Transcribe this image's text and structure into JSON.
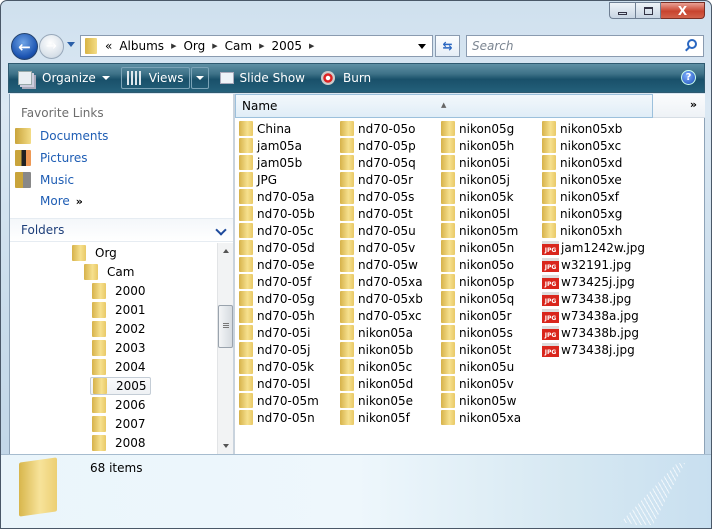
{
  "window": {
    "caption_buttons": [
      "minimize",
      "maximize",
      "close"
    ],
    "close_label": "X"
  },
  "nav": {
    "back_icon": "←",
    "forward_icon": "→",
    "address": {
      "overflow": "«",
      "crumbs": [
        "Albums",
        "Org",
        "Cam",
        "2005"
      ],
      "separator": "▶"
    },
    "refresh_icon": "⇆",
    "search_placeholder": "Search"
  },
  "toolbar": {
    "organize": "Organize",
    "views": "Views",
    "slideshow": "Slide Show",
    "burn": "Burn",
    "help": "?"
  },
  "nav_pane": {
    "favorites_header": "Favorite Links",
    "favorites": [
      {
        "label": "Documents",
        "icon": "documents-folder-icon"
      },
      {
        "label": "Pictures",
        "icon": "pictures-folder-icon"
      },
      {
        "label": "Music",
        "icon": "music-folder-icon"
      }
    ],
    "more": "More",
    "more_arrows": "»",
    "folders_header": "Folders",
    "tree": [
      {
        "label": "Org",
        "level": 0
      },
      {
        "label": "Cam",
        "level": 1
      },
      {
        "label": "2000",
        "level": 2
      },
      {
        "label": "2001",
        "level": 2
      },
      {
        "label": "2002",
        "level": 2
      },
      {
        "label": "2003",
        "level": 2
      },
      {
        "label": "2004",
        "level": 2
      },
      {
        "label": "2005",
        "level": 2,
        "selected": true
      },
      {
        "label": "2006",
        "level": 2
      },
      {
        "label": "2007",
        "level": 2
      },
      {
        "label": "2008",
        "level": 2
      }
    ]
  },
  "content": {
    "column_header": "Name",
    "column_more": "»",
    "columns": [
      [
        "China",
        "jam05a",
        "jam05b",
        "JPG",
        "nd70-05a",
        "nd70-05b",
        "nd70-05c",
        "nd70-05d",
        "nd70-05e",
        "nd70-05f",
        "nd70-05g",
        "nd70-05h",
        "nd70-05i",
        "nd70-05j",
        "nd70-05k",
        "nd70-05l",
        "nd70-05m",
        "nd70-05n"
      ],
      [
        "nd70-05o",
        "nd70-05p",
        "nd70-05q",
        "nd70-05r",
        "nd70-05s",
        "nd70-05t",
        "nd70-05u",
        "nd70-05v",
        "nd70-05w",
        "nd70-05xa",
        "nd70-05xb",
        "nd70-05xc",
        "nikon05a",
        "nikon05b",
        "nikon05c",
        "nikon05d",
        "nikon05e",
        "nikon05f"
      ],
      [
        "nikon05g",
        "nikon05h",
        "nikon05i",
        "nikon05j",
        "nikon05k",
        "nikon05l",
        "nikon05m",
        "nikon05n",
        "nikon05o",
        "nikon05p",
        "nikon05q",
        "nikon05r",
        "nikon05s",
        "nikon05t",
        "nikon05u",
        "nikon05v",
        "nikon05w",
        "nikon05xa"
      ],
      [
        "nikon05xb",
        "nikon05xc",
        "nikon05xd",
        "nikon05xe",
        "nikon05xf",
        "nikon05xg",
        "nikon05xh"
      ]
    ],
    "files": [
      "jam1242w.jpg",
      "w32191.jpg",
      "w73425j.jpg",
      "w73438.jpg",
      "w73438a.jpg",
      "w73438b.jpg",
      "w73438j.jpg"
    ],
    "jpg_badge": "JPG"
  },
  "details": {
    "item_count": "68 items"
  }
}
